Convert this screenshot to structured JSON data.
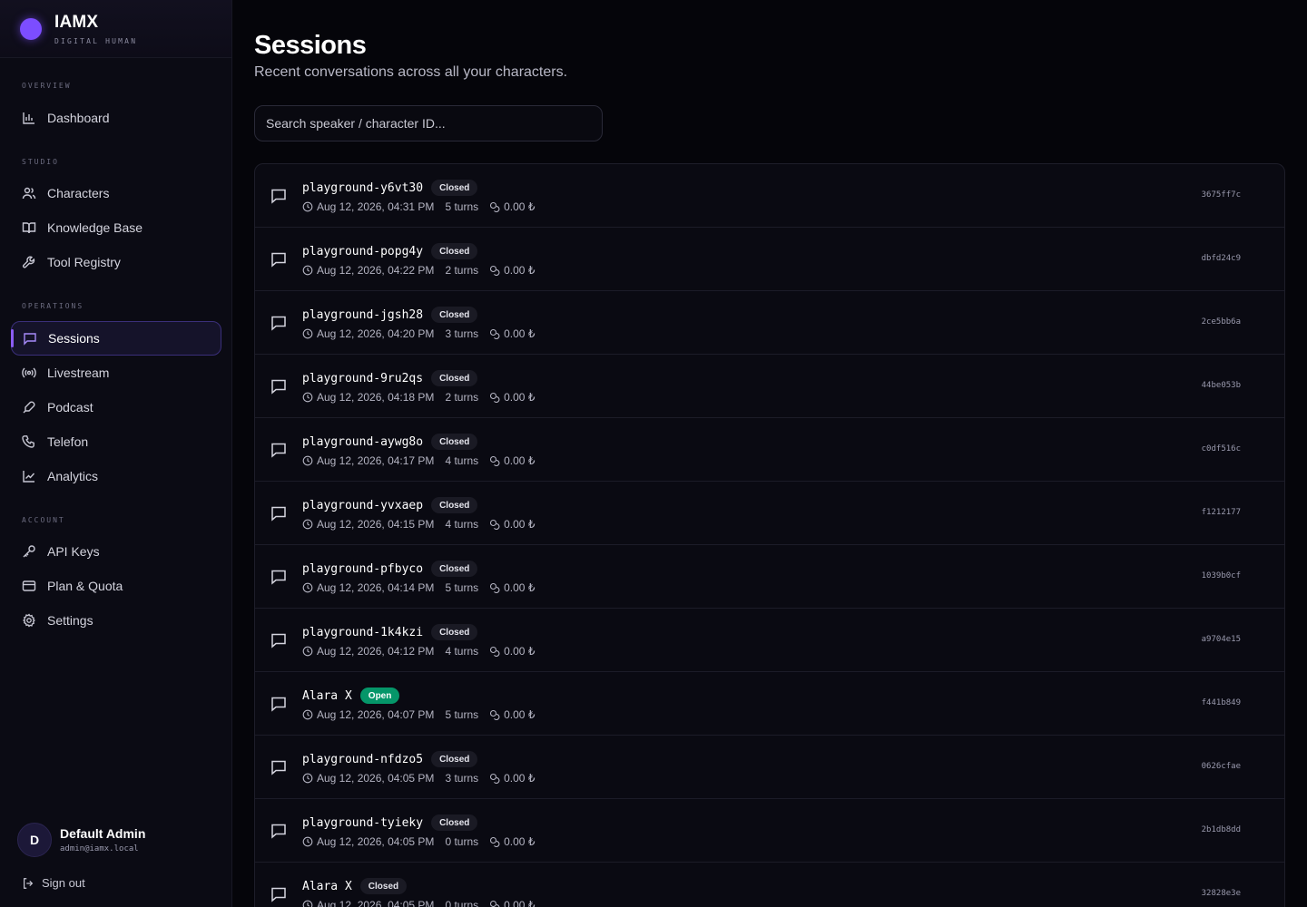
{
  "brand": {
    "name": "IAMX",
    "subtitle": "DIGITAL HUMAN"
  },
  "sidebar": {
    "sections": [
      {
        "label": "OVERVIEW",
        "items": [
          {
            "label": "Dashboard",
            "icon": "bar-chart-icon"
          }
        ]
      },
      {
        "label": "STUDIO",
        "items": [
          {
            "label": "Characters",
            "icon": "users-icon"
          },
          {
            "label": "Knowledge Base",
            "icon": "book-icon"
          },
          {
            "label": "Tool Registry",
            "icon": "wrench-icon"
          }
        ]
      },
      {
        "label": "OPERATIONS",
        "items": [
          {
            "label": "Sessions",
            "icon": "message-square-icon",
            "active": true
          },
          {
            "label": "Livestream",
            "icon": "radio-icon"
          },
          {
            "label": "Podcast",
            "icon": "mic-icon"
          },
          {
            "label": "Telefon",
            "icon": "phone-icon"
          },
          {
            "label": "Analytics",
            "icon": "line-chart-icon"
          }
        ]
      },
      {
        "label": "ACCOUNT",
        "items": [
          {
            "label": "API Keys",
            "icon": "key-icon"
          },
          {
            "label": "Plan & Quota",
            "icon": "credit-card-icon"
          },
          {
            "label": "Settings",
            "icon": "gear-icon"
          }
        ]
      }
    ]
  },
  "user": {
    "initial": "D",
    "name": "Default Admin",
    "email": "admin@iamx.local"
  },
  "signout_label": "Sign out",
  "page": {
    "title": "Sessions",
    "subtitle": "Recent conversations across all your characters."
  },
  "search": {
    "placeholder": "Search speaker / character ID..."
  },
  "sessions": [
    {
      "name": "playground-y6vt30",
      "status": "Closed",
      "date": "Aug 12, 2026, 04:31 PM",
      "turns": "5 turns",
      "cost": "0.00 ₺",
      "id": "3675ff7c"
    },
    {
      "name": "playground-popg4y",
      "status": "Closed",
      "date": "Aug 12, 2026, 04:22 PM",
      "turns": "2 turns",
      "cost": "0.00 ₺",
      "id": "dbfd24c9"
    },
    {
      "name": "playground-jgsh28",
      "status": "Closed",
      "date": "Aug 12, 2026, 04:20 PM",
      "turns": "3 turns",
      "cost": "0.00 ₺",
      "id": "2ce5bb6a"
    },
    {
      "name": "playground-9ru2qs",
      "status": "Closed",
      "date": "Aug 12, 2026, 04:18 PM",
      "turns": "2 turns",
      "cost": "0.00 ₺",
      "id": "44be053b"
    },
    {
      "name": "playground-aywg8o",
      "status": "Closed",
      "date": "Aug 12, 2026, 04:17 PM",
      "turns": "4 turns",
      "cost": "0.00 ₺",
      "id": "c0df516c"
    },
    {
      "name": "playground-yvxaep",
      "status": "Closed",
      "date": "Aug 12, 2026, 04:15 PM",
      "turns": "4 turns",
      "cost": "0.00 ₺",
      "id": "f1212177"
    },
    {
      "name": "playground-pfbyco",
      "status": "Closed",
      "date": "Aug 12, 2026, 04:14 PM",
      "turns": "5 turns",
      "cost": "0.00 ₺",
      "id": "1039b0cf"
    },
    {
      "name": "playground-1k4kzi",
      "status": "Closed",
      "date": "Aug 12, 2026, 04:12 PM",
      "turns": "4 turns",
      "cost": "0.00 ₺",
      "id": "a9704e15"
    },
    {
      "name": "Alara X",
      "status": "Open",
      "date": "Aug 12, 2026, 04:07 PM",
      "turns": "5 turns",
      "cost": "0.00 ₺",
      "id": "f441b849"
    },
    {
      "name": "playground-nfdzo5",
      "status": "Closed",
      "date": "Aug 12, 2026, 04:05 PM",
      "turns": "3 turns",
      "cost": "0.00 ₺",
      "id": "0626cfae"
    },
    {
      "name": "playground-tyieky",
      "status": "Closed",
      "date": "Aug 12, 2026, 04:05 PM",
      "turns": "0 turns",
      "cost": "0.00 ₺",
      "id": "2b1db8dd"
    },
    {
      "name": "Alara X",
      "status": "Closed",
      "date": "Aug 12, 2026, 04:05 PM",
      "turns": "0 turns",
      "cost": "0.00 ₺",
      "id": "32828e3e"
    }
  ]
}
